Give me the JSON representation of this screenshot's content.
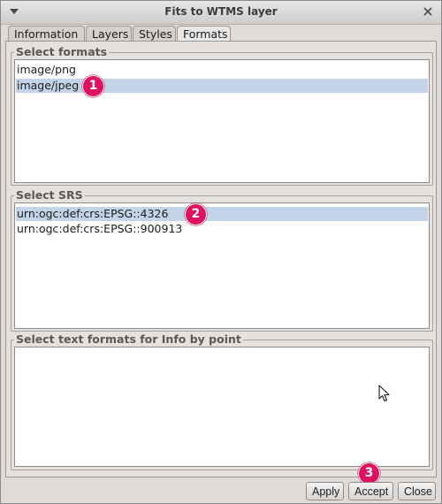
{
  "window": {
    "title": "Fits to WTMS layer"
  },
  "tabs": [
    {
      "label": "Information",
      "active": false
    },
    {
      "label": "Layers",
      "active": false
    },
    {
      "label": "Styles",
      "active": false
    },
    {
      "label": "Formats",
      "active": true
    }
  ],
  "formats": {
    "title": "Select formats",
    "items": [
      {
        "label": "image/png",
        "selected": false
      },
      {
        "label": "image/jpeg",
        "selected": true
      }
    ]
  },
  "srs": {
    "title": "Select SRS",
    "items": [
      {
        "label": "urn:ogc:def:crs:EPSG::4326",
        "selected": true
      },
      {
        "label": "urn:ogc:def:crs:EPSG::900913",
        "selected": false
      }
    ]
  },
  "info_formats": {
    "title": "Select text formats for Info by point",
    "items": []
  },
  "badges": {
    "step1": "1",
    "step2": "2",
    "step3": "3"
  },
  "buttons": {
    "apply": "Apply",
    "accept": "Accept",
    "close": "Close"
  },
  "colors": {
    "selection": "#c3d3e8",
    "badge": "#e0115f"
  },
  "icons": {
    "window_menu": "triangle-down-icon",
    "window_close": "close-x-icon",
    "pointer": "mouse-pointer-icon"
  }
}
